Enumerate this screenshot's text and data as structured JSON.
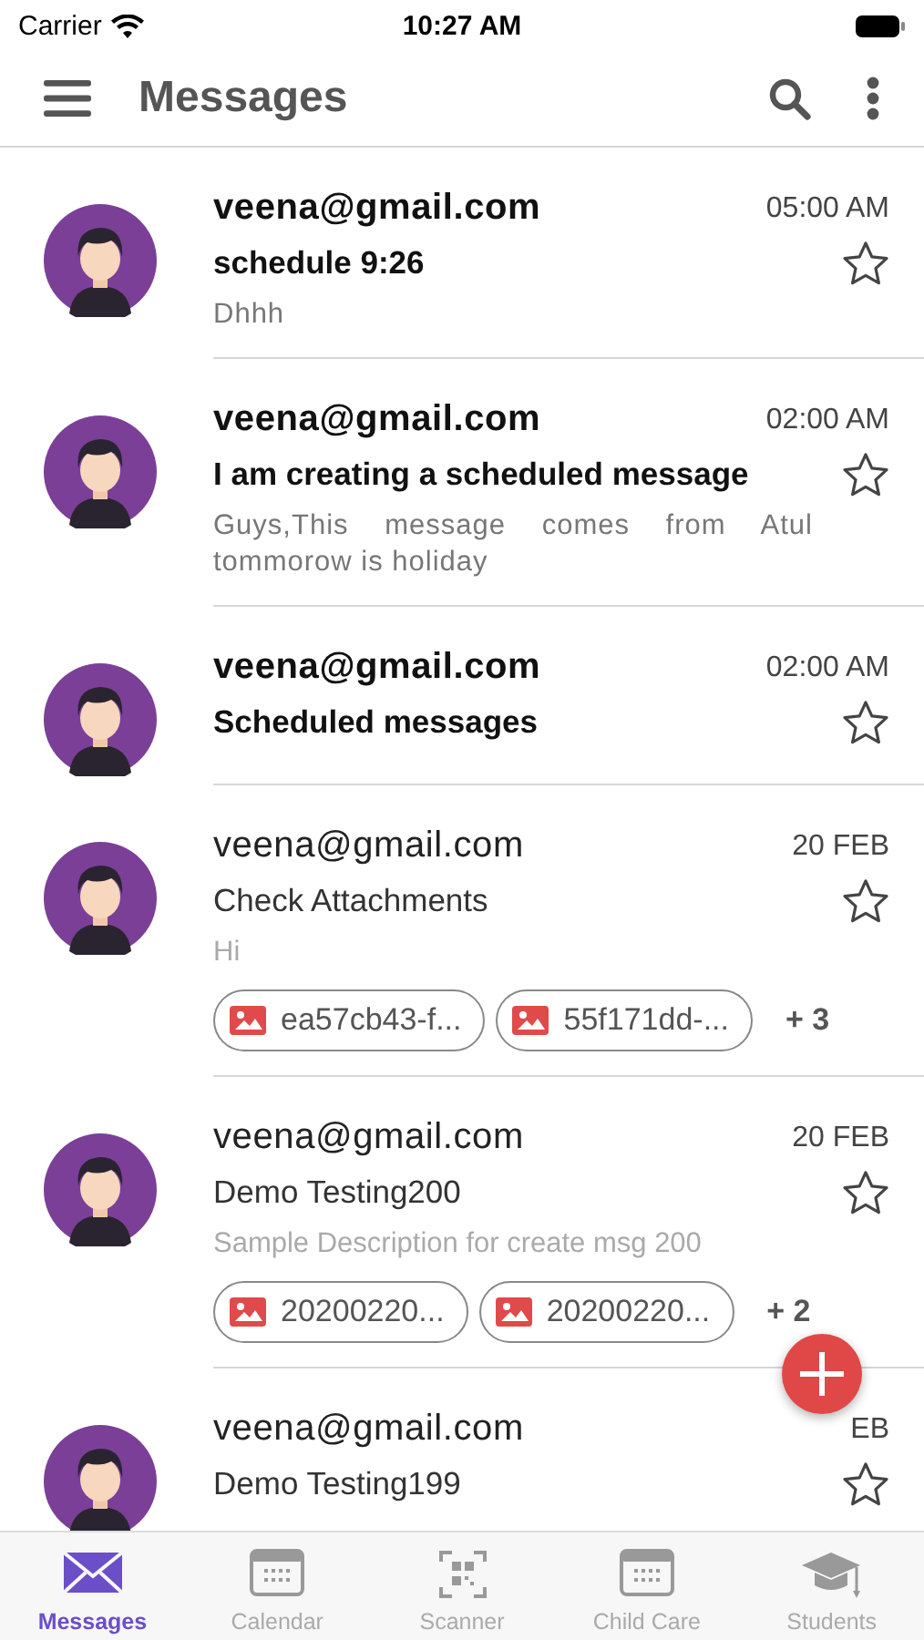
{
  "status_bar": {
    "carrier": "Carrier",
    "time": "10:27 AM"
  },
  "header": {
    "title": "Messages"
  },
  "messages": [
    {
      "sender": "veena@gmail.com",
      "time": "05:00 AM",
      "subject": "schedule 9:26",
      "preview": "Dhhh",
      "unread": true,
      "starred": false
    },
    {
      "sender": "veena@gmail.com",
      "time": "02:00 AM",
      "subject": "I am creating a scheduled message",
      "preview": "Guys,This message comes from Atul tommorow is holiday",
      "unread": true,
      "starred": false
    },
    {
      "sender": "veena@gmail.com",
      "time": "02:00 AM",
      "subject": "Scheduled messages",
      "unread": true,
      "starred": false
    },
    {
      "sender": "veena@gmail.com",
      "time": "20 FEB",
      "subject": "Check Attachments",
      "preview": "Hi",
      "unread": false,
      "starred": false,
      "attachments": [
        "ea57cb43-f...",
        "55f171dd-..."
      ],
      "more": "+ 3"
    },
    {
      "sender": "veena@gmail.com",
      "time": "20 FEB",
      "subject": "Demo Testing200",
      "preview": "Sample Description for create msg 200",
      "unread": false,
      "starred": false,
      "attachments": [
        "20200220...",
        "20200220..."
      ],
      "more": "+ 2"
    },
    {
      "sender": "veena@gmail.com",
      "time": "EB",
      "subject": "Demo Testing199",
      "unread": false,
      "starred": false
    }
  ],
  "tabs": [
    {
      "label": "Messages",
      "kind": "mail",
      "selected": true
    },
    {
      "label": "Calendar",
      "kind": "calendar",
      "selected": false
    },
    {
      "label": "Scanner",
      "kind": "scanner",
      "selected": false
    },
    {
      "label": "Child Care",
      "kind": "calendar",
      "selected": false
    },
    {
      "label": "Students",
      "kind": "cap",
      "selected": false
    }
  ]
}
